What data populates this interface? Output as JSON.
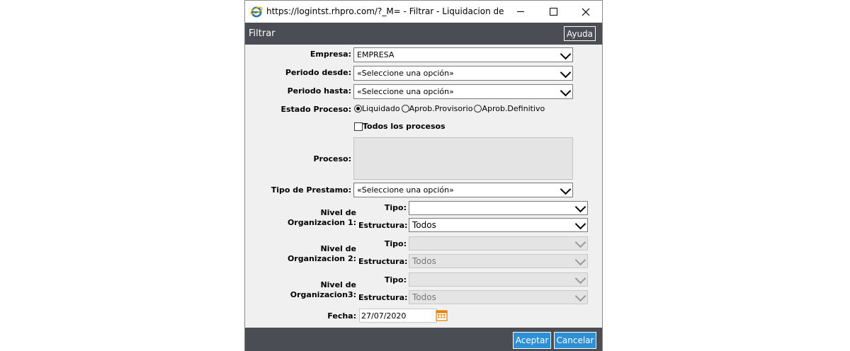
{
  "window": {
    "title": "https://logintst.rhpro.com/?_M= - Filtrar - Liquidacion de Ha..."
  },
  "header": {
    "title": "Filtrar",
    "help_label": "Ayuda"
  },
  "form": {
    "empresa": {
      "label": "Empresa:",
      "value": "EMPRESA"
    },
    "periodo_desde": {
      "label": "Periodo desde:",
      "value": "«Seleccione una opción»"
    },
    "periodo_hasta": {
      "label": "Periodo hasta:",
      "value": "«Seleccione una opción»"
    },
    "estado": {
      "label": "Estado Proceso:",
      "options": [
        "Liquidado",
        "Aprob.Provisorio",
        "Aprob.Definitivo"
      ],
      "selected": "Liquidado"
    },
    "todos_procesos": {
      "label": "Todos los procesos",
      "checked": false
    },
    "proceso": {
      "label": "Proceso:"
    },
    "tipo_prestamo": {
      "label": "Tipo de Prestamo:",
      "value": "«Seleccione una opción»"
    },
    "niveles": [
      {
        "label_line1": "Nivel de",
        "label_line2": "Organizacion 1:",
        "tipo_label": "Tipo:",
        "tipo_value": "",
        "estructura_label": "Estructura:",
        "estructura_value": "Todos",
        "enabled": true
      },
      {
        "label_line1": "Nivel de",
        "label_line2": "Organizacion 2:",
        "tipo_label": "Tipo:",
        "tipo_value": "",
        "estructura_label": "Estructura:",
        "estructura_value": "Todos",
        "enabled": false
      },
      {
        "label_line1": "Nivel de",
        "label_line2": "Organizacion3:",
        "tipo_label": "Tipo:",
        "tipo_value": "",
        "estructura_label": "Estructura:",
        "estructura_value": "Todos",
        "enabled": false
      }
    ],
    "fecha": {
      "label": "Fecha:",
      "value": "27/07/2020"
    }
  },
  "footer": {
    "accept_label": "Aceptar",
    "cancel_label": "Cancelar"
  },
  "colors": {
    "header_bg": "#4a4d54",
    "button_blue": "#2f8fd5",
    "calendar_orange": "#e8820c"
  }
}
